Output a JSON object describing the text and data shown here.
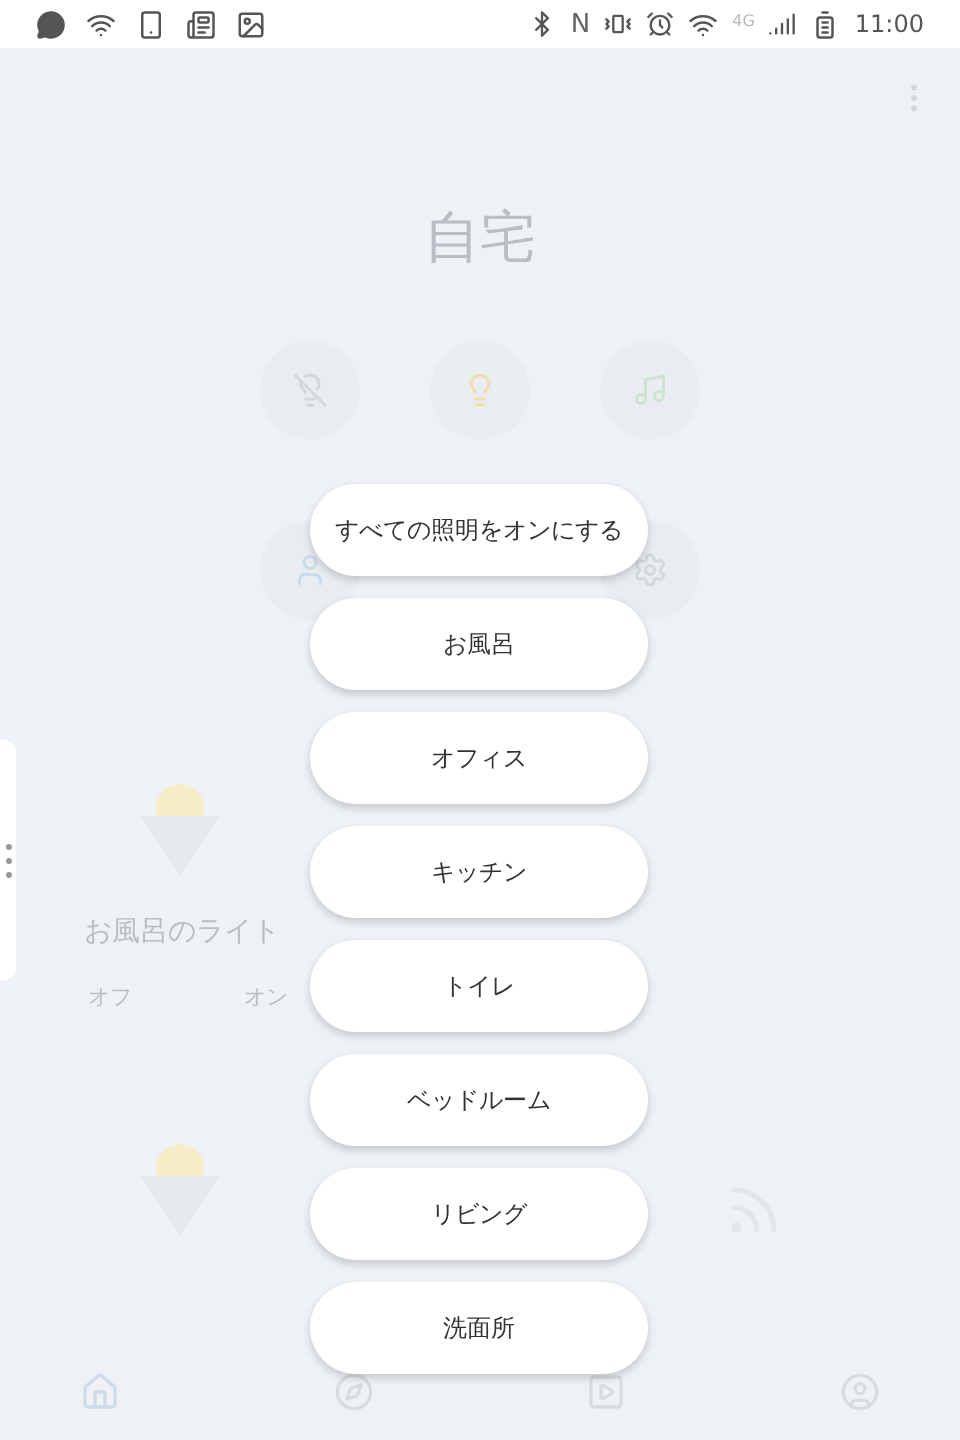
{
  "status_bar": {
    "nfc": "N",
    "network": "4G",
    "time": "11:00"
  },
  "screen": {
    "title": "自宅",
    "device": {
      "name": "お風呂のライト",
      "options": [
        "オフ",
        "オン"
      ]
    }
  },
  "menu": {
    "items": [
      {
        "label": "すべての照明をオンにする"
      },
      {
        "label": "お風呂"
      },
      {
        "label": "オフィス"
      },
      {
        "label": "キッチン"
      },
      {
        "label": "トイレ"
      },
      {
        "label": "ベッドルーム"
      },
      {
        "label": "リビング"
      },
      {
        "label": "洗面所"
      }
    ]
  }
}
